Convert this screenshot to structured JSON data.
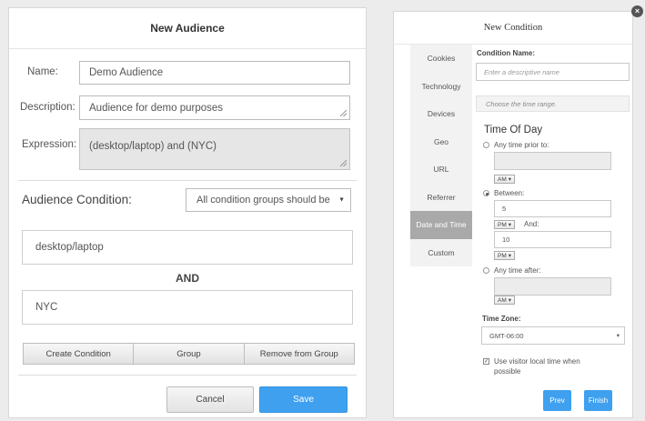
{
  "audience_dialog": {
    "title": "New Audience",
    "name_label": "Name:",
    "name_value": "Demo Audience",
    "description_label": "Description:",
    "description_value": "Audience for demo purposes",
    "expression_label": "Expression:",
    "expression_value": "(desktop/laptop) and (NYC)",
    "condition_section_title": "Audience Condition:",
    "condition_select_value": "All condition groups should be",
    "conditions": [
      "desktop/laptop",
      "NYC"
    ],
    "and_label": "AND",
    "buttons": {
      "create_condition": "Create Condition",
      "group": "Group",
      "remove_from_group": "Remove from Group",
      "cancel": "Cancel",
      "save": "Save"
    }
  },
  "condition_dialog": {
    "title": "New Condition",
    "nav_items": [
      "Cookies",
      "Technology",
      "Devices",
      "Geo",
      "URL",
      "Referrer",
      "Date and Time",
      "Custom"
    ],
    "active_nav": "Date and Time",
    "condition_name_label": "Condition Name:",
    "condition_name_placeholder": "Enter a descriptive name",
    "hint": "Choose the time range.",
    "section_title": "Time Of Day",
    "prior_label": "Any time prior to:",
    "prior_ampm": "AM",
    "between_label": "Between:",
    "between_start": "5",
    "between_start_ampm": "PM",
    "and_label": "And:",
    "between_end": "10",
    "between_end_ampm": "PM",
    "after_label": "Any time after:",
    "after_ampm": "AM",
    "timezone_label": "Time Zone:",
    "timezone_value": "GMT-06:00",
    "local_time_label_line1": "Use visitor local time when",
    "local_time_label_line2": "possible",
    "prev_label": "Prev",
    "finish_label": "Finish",
    "close_glyph": "×"
  },
  "colors": {
    "primary_button": "#3fa0ef",
    "active_nav": "#a9a9a9",
    "disabled_field": "#e6e6e6"
  },
  "icons": {
    "dropdown": "chevron-down-icon",
    "resize": "resize-grip-icon",
    "close": "close-icon"
  }
}
